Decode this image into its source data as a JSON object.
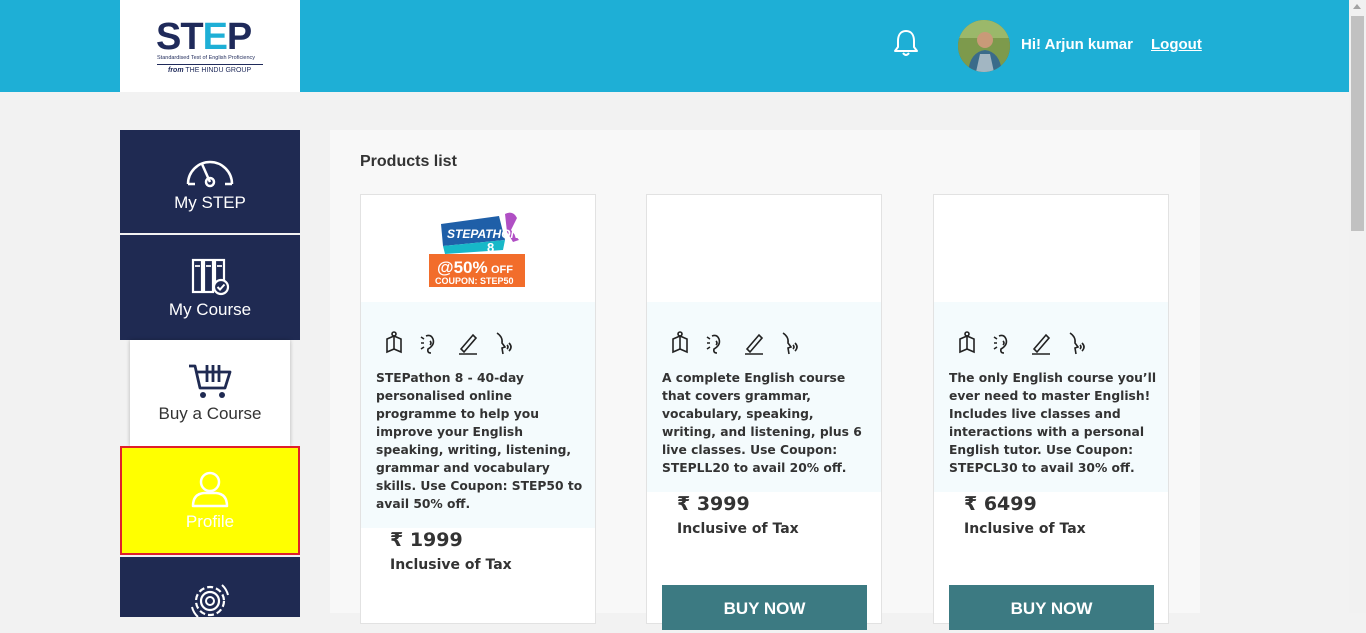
{
  "header": {
    "logo": {
      "text_main": "STEP",
      "tagline": "Standardised Test of English Proficiency",
      "from_label": "from",
      "group": "THE HINDU GROUP"
    },
    "greeting": "Hi! Arjun kumar",
    "logout_label": "Logout"
  },
  "sidebar": {
    "items": [
      {
        "label": "My STEP",
        "icon": "speedometer-icon"
      },
      {
        "label": "My Course",
        "icon": "books-check-icon"
      },
      {
        "label": "Buy a Course",
        "icon": "shopping-cart-icon"
      },
      {
        "label": "Profile",
        "icon": "user-icon"
      },
      {
        "label": "",
        "icon": "gear-icon"
      }
    ]
  },
  "main": {
    "title": "Products list",
    "products": [
      {
        "promo": {
          "title": "STEPATHON",
          "number": "8",
          "discount": "@50%",
          "off": "OFF",
          "coupon": "COUPON: STEP50"
        },
        "description": "STEPathon 8 - 40-day personalised online programme to help you improve your English speaking, writing, listening, grammar and vocabulary skills. Use Coupon: STEP50 to avail 50% off.",
        "price": "₹ 1999",
        "tax_note": "Inclusive of Tax",
        "button": ""
      },
      {
        "description": "A complete English course that covers grammar, vocabulary, speaking, writing, and listening, plus 6 live classes. Use Coupon: STEPLL20 to avail 20% off.",
        "price": "₹ 3999",
        "tax_note": "Inclusive of Tax",
        "button": "BUY NOW"
      },
      {
        "description": "The only English course you’ll ever need to master English! Includes live classes and interactions with a personal English tutor. Use Coupon: STEPCL30 to avail 30% off.",
        "price": "₹ 6499",
        "tax_note": "Inclusive of Tax",
        "button": "BUY NOW"
      }
    ],
    "skill_icons": [
      "reading-book-icon",
      "listening-ear-icon",
      "writing-pen-icon",
      "speaking-head-icon"
    ]
  },
  "colors": {
    "header": "#1eafd6",
    "nav": "#1f2a52",
    "profile_highlight": "#ffff00",
    "button": "#3c7a82"
  }
}
